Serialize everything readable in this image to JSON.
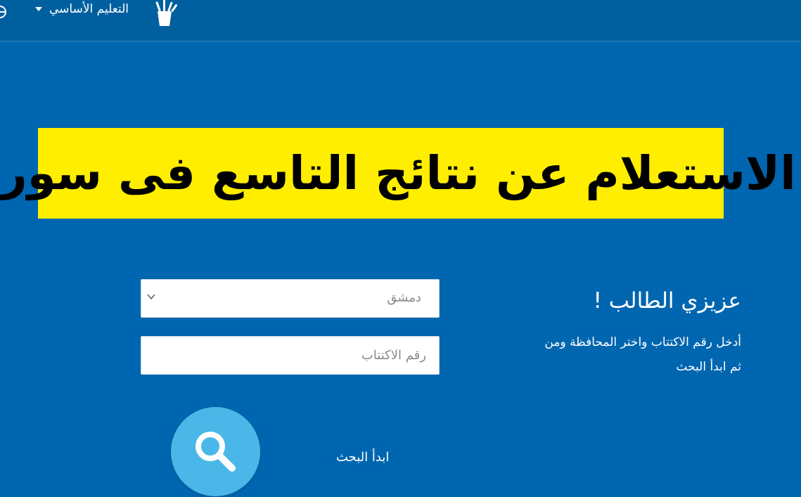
{
  "header": {
    "nav_label": "التعليم الأساسي",
    "icons": [
      "globe-icon",
      "caret-down-icon",
      "pencil-cup-icon"
    ]
  },
  "banner": {
    "title": "الاستعلام عن نتائج التاسع فى سوريا"
  },
  "form": {
    "greeting": "عزيزي الطالب !",
    "instruction_line1": "أدخل رقم الاكتتاب واختر المحافظة ومن",
    "instruction_line2": "ثم ابدأ البحث",
    "governorate_selected": "دمشق",
    "subscription_placeholder": "رقم الاكتتاب",
    "search_label": "ابدأ البحث"
  },
  "colors": {
    "background": "#0066b0",
    "header": "#00609f",
    "banner": "#ffee00",
    "search_button": "#4ab7e8"
  }
}
